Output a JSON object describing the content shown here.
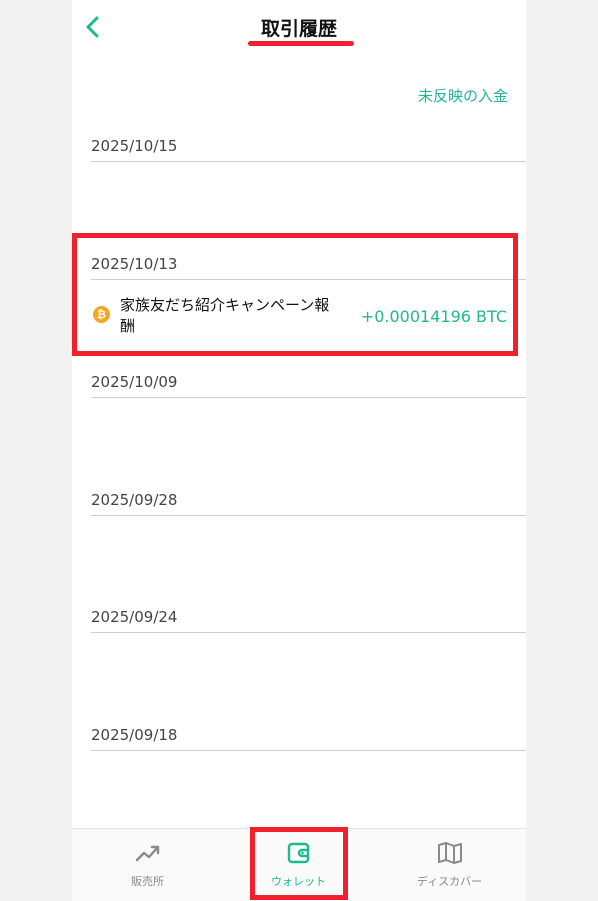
{
  "header": {
    "title": "取引履歴",
    "back_icon": "chevron-left-icon"
  },
  "unreflected_link": "未反映の入金",
  "dates": [
    "2025/10/15",
    "2025/10/13",
    "2025/10/09",
    "2025/09/28",
    "2025/09/24",
    "2025/09/18"
  ],
  "transaction": {
    "icon": "bitcoin-icon",
    "icon_glyph": "₿",
    "title": "家族友だち紹介キャンペーン報酬",
    "amount": "+0.00014196 BTC"
  },
  "nav": [
    {
      "label": "販売所",
      "icon": "trend-chart-icon",
      "active": false
    },
    {
      "label": "ウォレット",
      "icon": "wallet-icon",
      "active": true
    },
    {
      "label": "ディスカバー",
      "icon": "map-icon",
      "active": false
    }
  ],
  "colors": {
    "accent": "#1fb98a",
    "highlight": "#f0212d",
    "btc": "#f5a623"
  }
}
